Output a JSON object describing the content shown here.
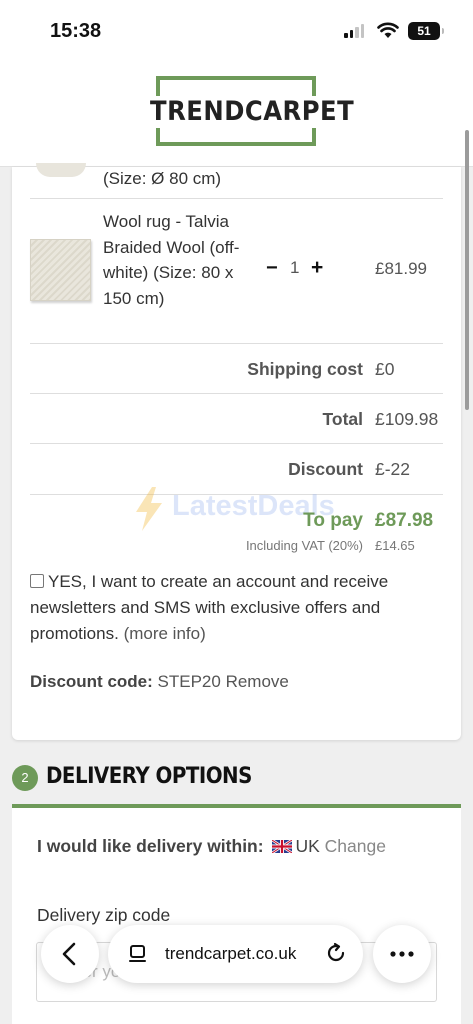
{
  "status_bar": {
    "time": "15:38",
    "battery": "51"
  },
  "header": {
    "logo_text": "TRENDCARPET"
  },
  "cart": {
    "partial_item_size": "(Size: Ø 80 cm)",
    "item": {
      "name": "Wool rug - Talvia Braided Wool (off-white) (Size: 80 x 150 cm)",
      "quantity": "1",
      "price": "£81.99",
      "minus": "−",
      "plus": "+"
    },
    "shipping": {
      "label": "Shipping cost",
      "value": "£0"
    },
    "total": {
      "label": "Total",
      "value": "£109.98"
    },
    "discount": {
      "label": "Discount",
      "value": "£-22"
    },
    "to_pay": {
      "label": "To pay",
      "value": "£87.98"
    },
    "vat": {
      "label": "Including VAT (20%)",
      "value": "£14.65"
    },
    "newsletter": {
      "text": "YES, I want to create an account and receive newsletters and SMS with exclusive offers and promotions.",
      "more": "(more info)"
    },
    "discount_code": {
      "label": "Discount code:",
      "code": "STEP20",
      "remove": "Remove"
    }
  },
  "watermark": {
    "text": "LatestDeals"
  },
  "delivery": {
    "step_number": "2",
    "title": "DELIVERY OPTIONS",
    "within_label": "I would like delivery within:",
    "country": "UK",
    "change": "Change",
    "zip_label": "Delivery zip code",
    "zip_placeholder": "Enter your zip code"
  },
  "browser": {
    "url": "trendcarpet.co.uk"
  },
  "colors": {
    "brand_green": "#6e9a59"
  }
}
